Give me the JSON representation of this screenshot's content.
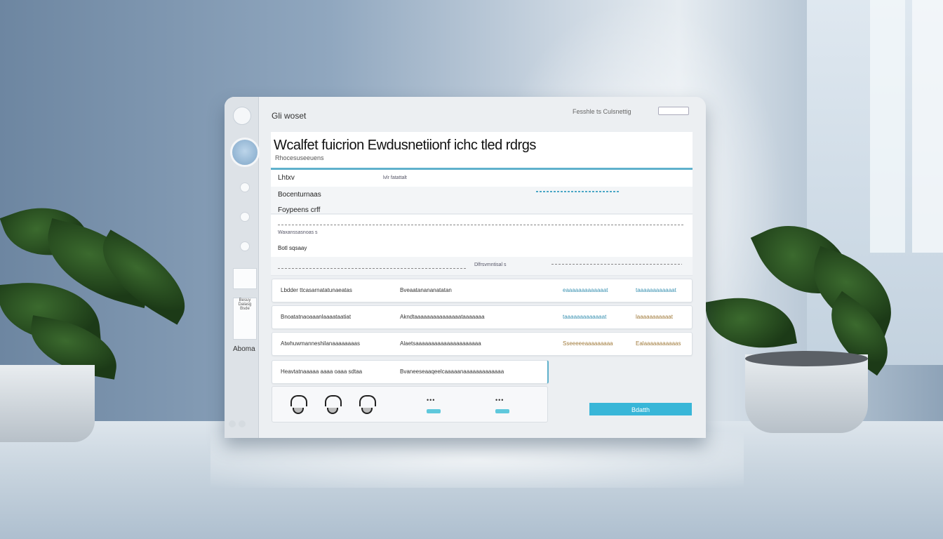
{
  "app": {
    "title": "Gli woset",
    "top_right_text": "Fesshle ts Culsnettig"
  },
  "header": {
    "heading": "Wcalfet fuicrion Ewdusnetiionf ichc tled rdrgs",
    "subheading": "Rhocesuseeuens"
  },
  "rows": [
    {
      "label": "Lhtxv",
      "value": "lvlr fatattalt"
    },
    {
      "label": "Bocenturnaas",
      "value": ""
    },
    {
      "label": "Foypeens crff",
      "value": ""
    },
    {
      "label": "Waxanssasnoas  s",
      "value": ""
    },
    {
      "label": "Botl sqsaay",
      "value": ""
    },
    {
      "label": "",
      "value": "Dlfrsvmntisal s"
    }
  ],
  "cards": [
    {
      "c1": "Lbdder ttcasarnatatunaeatas",
      "c2": "Bveaatanananatatan",
      "c3": "eaaaaaaaaaaaaat",
      "c4": "taaaaaaaaaaaat"
    },
    {
      "c1": "Bnoatatnaoaaanlaaaataatiat",
      "c2": "Akndtaaaaaaaaaaaaaaataaaaaaa",
      "c3": "taaaaaaaaaaaaat",
      "c4": "laaaaaaaaaaat"
    },
    {
      "c1": "Atwhuwmanneshilanaaaaaaaas",
      "c2": "Alaetsaaaaaaaaaaaaaaaaaaaaa",
      "c3": "Sseeeeeaaaaaaaaa",
      "c4": "Ealaaaaaaaaaaas"
    },
    {
      "c1": "Heavtatnaaaaa aaaa oaaa sdtaa",
      "c2": "Bvaneeseaaqeelcaaaaanaaaaaaaaaaaaa",
      "c3": "",
      "c4": ""
    }
  ],
  "sidebar": {
    "label": "Aboma",
    "card_text": "Besuy Dalasg Bsde"
  },
  "action": {
    "button_label": "Bdatth"
  },
  "colors": {
    "accent": "#5fb1cc",
    "button": "#38b6d8"
  }
}
